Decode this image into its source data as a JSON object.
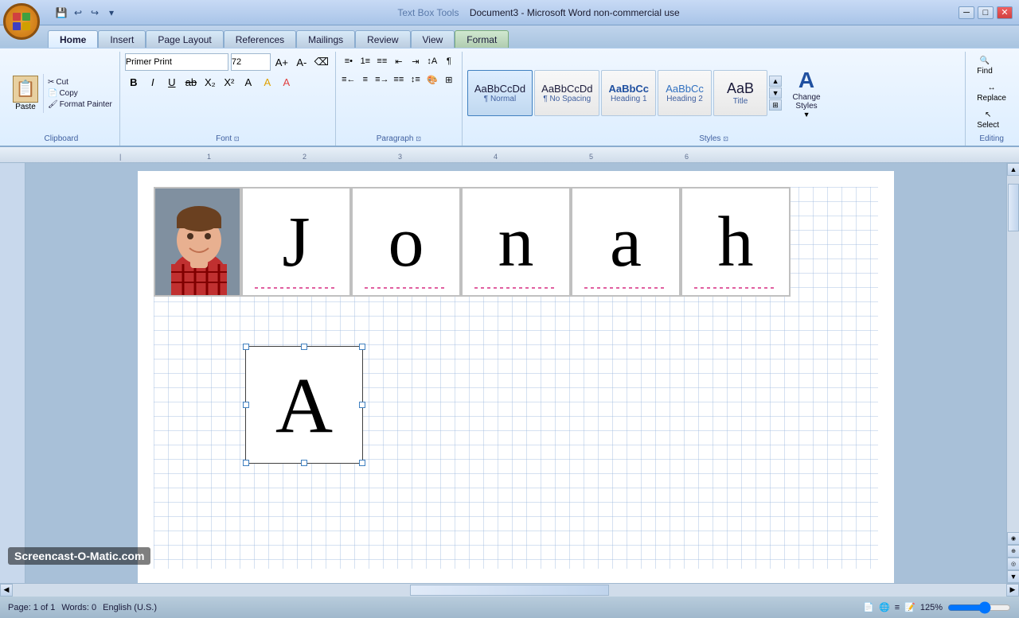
{
  "titlebar": {
    "title": "Document3 - Microsoft Word non-commercial use",
    "context": "Text Box Tools",
    "min_btn": "─",
    "max_btn": "□",
    "close_btn": "✕"
  },
  "quickaccess": {
    "save": "💾",
    "undo": "↩",
    "redo": "↪"
  },
  "tabs": [
    {
      "label": "Home",
      "active": true
    },
    {
      "label": "Insert",
      "active": false
    },
    {
      "label": "Page Layout",
      "active": false
    },
    {
      "label": "References",
      "active": false
    },
    {
      "label": "Mailings",
      "active": false
    },
    {
      "label": "Review",
      "active": false
    },
    {
      "label": "View",
      "active": false
    },
    {
      "label": "Format",
      "active": false,
      "context": true
    }
  ],
  "ribbon": {
    "clipboard": {
      "label": "Clipboard",
      "paste": "Paste",
      "cut": "Cut",
      "copy": "Copy",
      "format_painter": "Format Painter"
    },
    "font": {
      "label": "Font",
      "name": "Primer Print",
      "size": "72",
      "bold": "B",
      "italic": "I",
      "underline": "U"
    },
    "paragraph": {
      "label": "Paragraph"
    },
    "styles": {
      "label": "Styles",
      "items": [
        {
          "id": "normal",
          "preview": "AaBbCcDd",
          "label": "¶ Normal",
          "selected": true
        },
        {
          "id": "no-spacing",
          "preview": "AaBbCcDd",
          "label": "¶ No Spacing",
          "selected": false
        },
        {
          "id": "heading1",
          "preview": "AaBbCc",
          "label": "Heading 1",
          "selected": false
        },
        {
          "id": "heading2",
          "preview": "AaBbCc",
          "label": "Heading 2",
          "selected": false
        },
        {
          "id": "title",
          "preview": "AaB",
          "label": "Title",
          "selected": false
        }
      ],
      "change_styles": "Change Styles",
      "change_styles_icon": "▼"
    },
    "editing": {
      "label": "Editing",
      "find": "Find",
      "replace": "Replace",
      "select": "Select"
    }
  },
  "document": {
    "letters": [
      "J",
      "o",
      "n",
      "a",
      "h"
    ],
    "selected_letter": "A",
    "zoom": "125%"
  },
  "statusbar": {
    "page": "Page: 1 of 1",
    "words": "Words: 0",
    "zoom_label": "125%",
    "watermark": "Screencast-O-Matic.com"
  }
}
